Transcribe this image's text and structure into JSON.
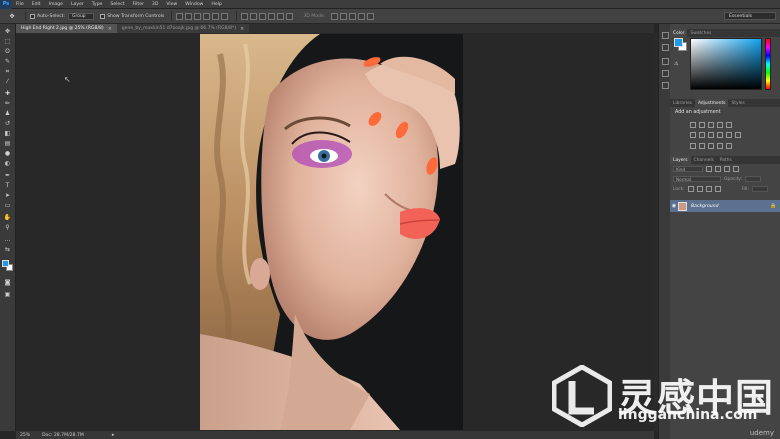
{
  "app": {
    "logo": "Ps"
  },
  "menu": [
    "File",
    "Edit",
    "Image",
    "Layer",
    "Type",
    "Select",
    "Filter",
    "3D",
    "View",
    "Window",
    "Help"
  ],
  "options": {
    "auto_select_label": "Auto-Select:",
    "auto_select_value": "Group",
    "transform_label": "Show Transform Controls",
    "mode_3d": "3D Mode:",
    "workspace": "Essentials"
  },
  "tabs": [
    {
      "label": "High End Right 2.jpg @ 25% (RGB/8)",
      "active": true
    },
    {
      "label": "gene_by_maxkin51 d7ooajk.jpg @ 66.7% (RGB/8*)",
      "active": false
    }
  ],
  "status": {
    "zoom": "25%",
    "doc": "Doc: 28.7M/28.7M"
  },
  "panels": {
    "color_tabs": [
      "Color",
      "Swatches"
    ],
    "adj_tabs": [
      "Libraries",
      "Adjustments",
      "Styles"
    ],
    "adj_title": "Add an adjustment",
    "layer_tabs": [
      "Layers",
      "Channels",
      "Paths"
    ],
    "kind": "Kind",
    "blend": "Normal",
    "opacity": "Opacity:",
    "lock": "Lock:",
    "fill": "Fill:",
    "layer_name": "Background"
  },
  "colors": {
    "foreground": "#1e9ae8",
    "background": "#ffffff",
    "layer_selected": "#5c718f"
  },
  "watermark": {
    "cn": "灵感中国",
    "en": "lingganchina.com",
    "udemy": "udemy"
  }
}
